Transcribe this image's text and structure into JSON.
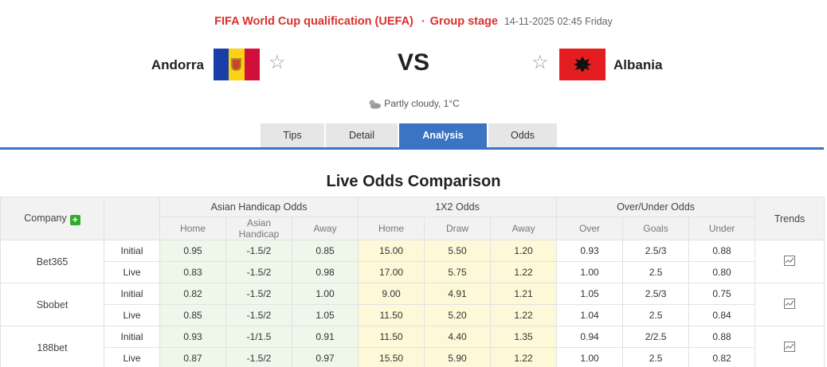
{
  "match": {
    "competition": "FIFA World Cup qualification (UEFA)",
    "separator": "·",
    "stage": "Group stage",
    "datetime": "14-11-2025 02:45 Friday",
    "home_team": "Andorra",
    "away_team": "Albania",
    "vs": "VS",
    "weather": "Partly cloudy, 1°C"
  },
  "tabs": [
    "Tips",
    "Detail",
    "Analysis",
    "Odds"
  ],
  "active_tab": "Analysis",
  "section_title": "Live Odds Comparison",
  "table": {
    "company_header": "Company",
    "plus": "+",
    "groups": [
      "Asian Handicap Odds",
      "1X2 Odds",
      "Over/Under Odds"
    ],
    "trends_header": "Trends",
    "sub_headers": [
      "Home",
      "Asian Handicap",
      "Away",
      "Home",
      "Draw",
      "Away",
      "Over",
      "Goals",
      "Under"
    ],
    "rows": [
      {
        "company": "Bet365",
        "lines": [
          {
            "type": "Initial",
            "values": [
              "0.95",
              "-1.5/2",
              "0.85",
              "15.00",
              "5.50",
              "1.20",
              "0.93",
              "2.5/3",
              "0.88"
            ]
          },
          {
            "type": "Live",
            "values": [
              "0.83",
              "-1.5/2",
              "0.98",
              "17.00",
              "5.75",
              "1.22",
              "1.00",
              "2.5",
              "0.80"
            ]
          }
        ]
      },
      {
        "company": "Sbobet",
        "lines": [
          {
            "type": "Initial",
            "values": [
              "0.82",
              "-1.5/2",
              "1.00",
              "9.00",
              "4.91",
              "1.21",
              "1.05",
              "2.5/3",
              "0.75"
            ]
          },
          {
            "type": "Live",
            "values": [
              "0.85",
              "-1.5/2",
              "1.05",
              "11.50",
              "5.20",
              "1.22",
              "1.04",
              "2.5",
              "0.84"
            ]
          }
        ]
      },
      {
        "company": "188bet",
        "lines": [
          {
            "type": "Initial",
            "values": [
              "0.93",
              "-1/1.5",
              "0.91",
              "11.50",
              "4.40",
              "1.35",
              "0.94",
              "2/2.5",
              "0.88"
            ]
          },
          {
            "type": "Live",
            "values": [
              "0.87",
              "-1.5/2",
              "0.97",
              "15.50",
              "5.90",
              "1.22",
              "1.00",
              "2.5",
              "0.82"
            ]
          }
        ]
      }
    ]
  },
  "colors": {
    "accent": "#3b74c3",
    "competition": "#d9302c",
    "asian_bg": "#edf7ea",
    "x2_bg": "#fdf9d8"
  }
}
